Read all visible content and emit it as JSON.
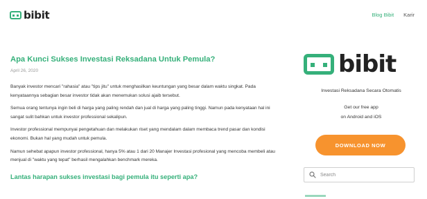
{
  "header": {
    "brand": "bibit",
    "nav": [
      {
        "label": "Blog Bibit",
        "active": true
      },
      {
        "label": "Karir",
        "active": false
      }
    ]
  },
  "article": {
    "title": "Apa Kunci Sukses Investasi Reksadana Untuk Pemula?",
    "date": "April 26, 2020",
    "paragraphs": [
      "Banyak investor mencari \"rahasia\" atau \"tips jitu\" untuk menghasilkan keuntungan yang besar dalam waktu singkat. Pada kenyataannya sebagian besar investor tidak akan menemukan solusi ajaib tersebut.",
      "Semua orang tentunya ingin beli di harga yang paling rendah dan jual di harga yang paling tinggi. Namun pada kenyataan hal ini sangat sulit bahkan untuk investor professional sekalipun.",
      "Investor professional mempunyai pengetahuan dan melakukan riset yang mendalam dalam membaca trend pasar dan kondisi ekonomi. Bukan hal yang mudah untuk pemula.",
      "Namun sehebat apapun investor professional, hanya 5% atau 1 dari 20 Manajer Investasi profesional yang mencoba membeli atau menjual di \"waktu yang tepat\" berhasil mengalahkan benchmark mereka."
    ],
    "subheading": "Lantas harapan sukses investasi bagi pemula itu seperti apa?"
  },
  "sidebar": {
    "brand": "bibit",
    "tagline": "Investasi Reksadana Secara Otomatis",
    "app_line1": "Get our free app",
    "app_line2": "on Android and iOS",
    "download_label": "DOWNLOAD NOW",
    "search_placeholder": "Search"
  },
  "colors": {
    "accent": "#35b07a",
    "button": "#f7932e"
  }
}
